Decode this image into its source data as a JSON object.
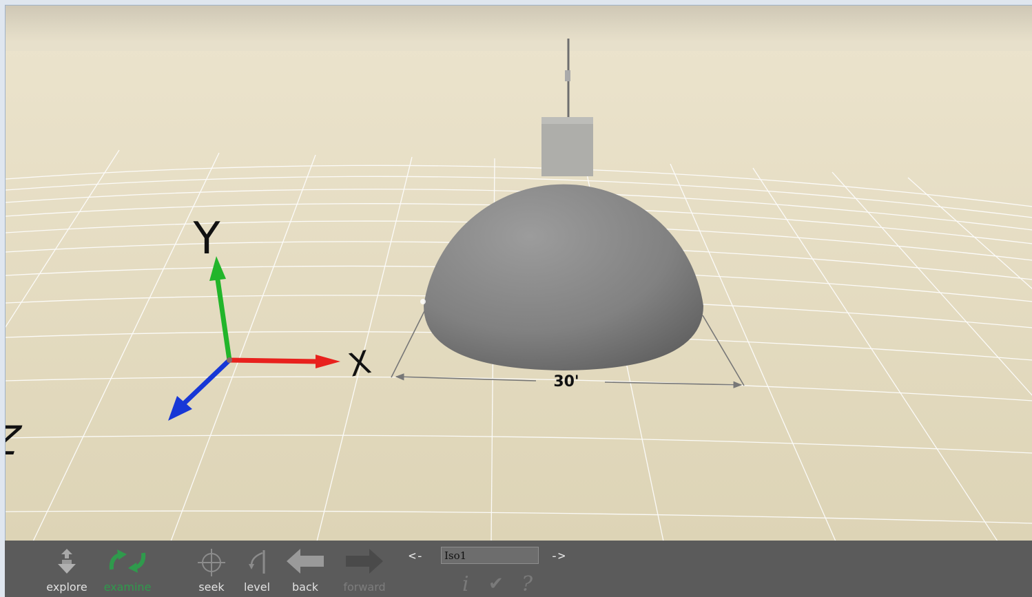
{
  "scene": {
    "axes": {
      "x_label": "X",
      "y_label": "Y",
      "z_label": "Z"
    },
    "dimension_label": "30'"
  },
  "toolbar": {
    "tools": [
      {
        "label": "explore"
      },
      {
        "label": "examine"
      },
      {
        "label": "seek"
      },
      {
        "label": "level"
      },
      {
        "label": "back"
      },
      {
        "label": "forward"
      }
    ],
    "viewpoint_prev": "<-",
    "viewpoint_next": "->",
    "viewpoint_value": "Iso1",
    "info_icon_glyph": "i",
    "check_icon_glyph": "✔",
    "help_icon_glyph": "?"
  },
  "colors": {
    "x_axis": "#e8211d",
    "y_axis": "#22b52a",
    "z_axis": "#1737d6",
    "toolbar_bg": "#5b5b5b",
    "active_tool": "#2f9a4c"
  }
}
